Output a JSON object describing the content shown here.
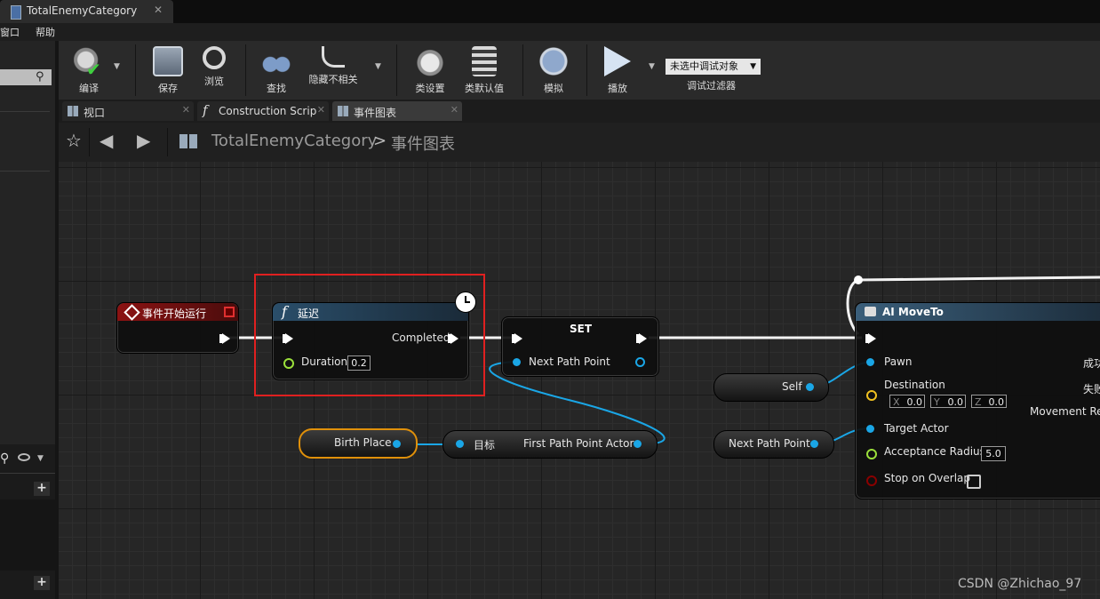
{
  "window": {
    "tab_title": "TotalEnemyCategory",
    "close": "✕"
  },
  "menu": {
    "items": [
      "窗口",
      "帮助"
    ]
  },
  "toolbar": {
    "compile": "编译",
    "save": "保存",
    "browse": "浏览",
    "find": "查找",
    "hide_unrelated": "隐藏不相关",
    "class_settings": "类设置",
    "class_defaults": "类默认值",
    "simulate": "模拟",
    "play": "播放",
    "debug_object": "未选中调试对象",
    "debug_filter": "调试过滤器"
  },
  "doc_tabs": {
    "viewport": "视口",
    "construction": "Construction Scrip",
    "event_graph": "事件图表"
  },
  "breadcrumb": {
    "blueprint": "TotalEnemyCategory",
    "separator": ">",
    "graph": "事件图表"
  },
  "nodes": {
    "begin_play": {
      "title": "事件开始运行"
    },
    "delay": {
      "title": "延迟",
      "completed": "Completed",
      "duration_label": "Duration",
      "duration_value": "0.2"
    },
    "set": {
      "title": "SET",
      "next_path_point": "Next Path Point"
    },
    "self": {
      "label": "Self"
    },
    "birth_place": {
      "label": "Birth Place"
    },
    "get_first": {
      "target": "目标",
      "output": "First Path Point Actor"
    },
    "next_path_var": {
      "label": "Next Path Point"
    },
    "ai_moveto": {
      "title": "AI MoveTo",
      "pawn": "Pawn",
      "destination": "Destination",
      "x_label": "X",
      "x_value": "0.0",
      "y_label": "Y",
      "y_value": "0.0",
      "z_label": "Z",
      "z_value": "0.0",
      "target_actor": "Target Actor",
      "acceptance_radius": "Acceptance Radius",
      "acceptance_value": "5.0",
      "stop_on_overlap": "Stop on Overlap",
      "on_success": "成功",
      "on_fail": "失败",
      "movement_result": "Movement Res"
    }
  },
  "watermark": "CSDN @Zhichao_97",
  "colors": {
    "begin_play_header": "#8b1212",
    "function_header": "#2a4e6a",
    "highlight": "#e02020",
    "object_pin": "#1aa6e6",
    "float_pin": "#9be03b",
    "vector_pin": "#f0c020",
    "bool_pin": "#8a0000"
  }
}
